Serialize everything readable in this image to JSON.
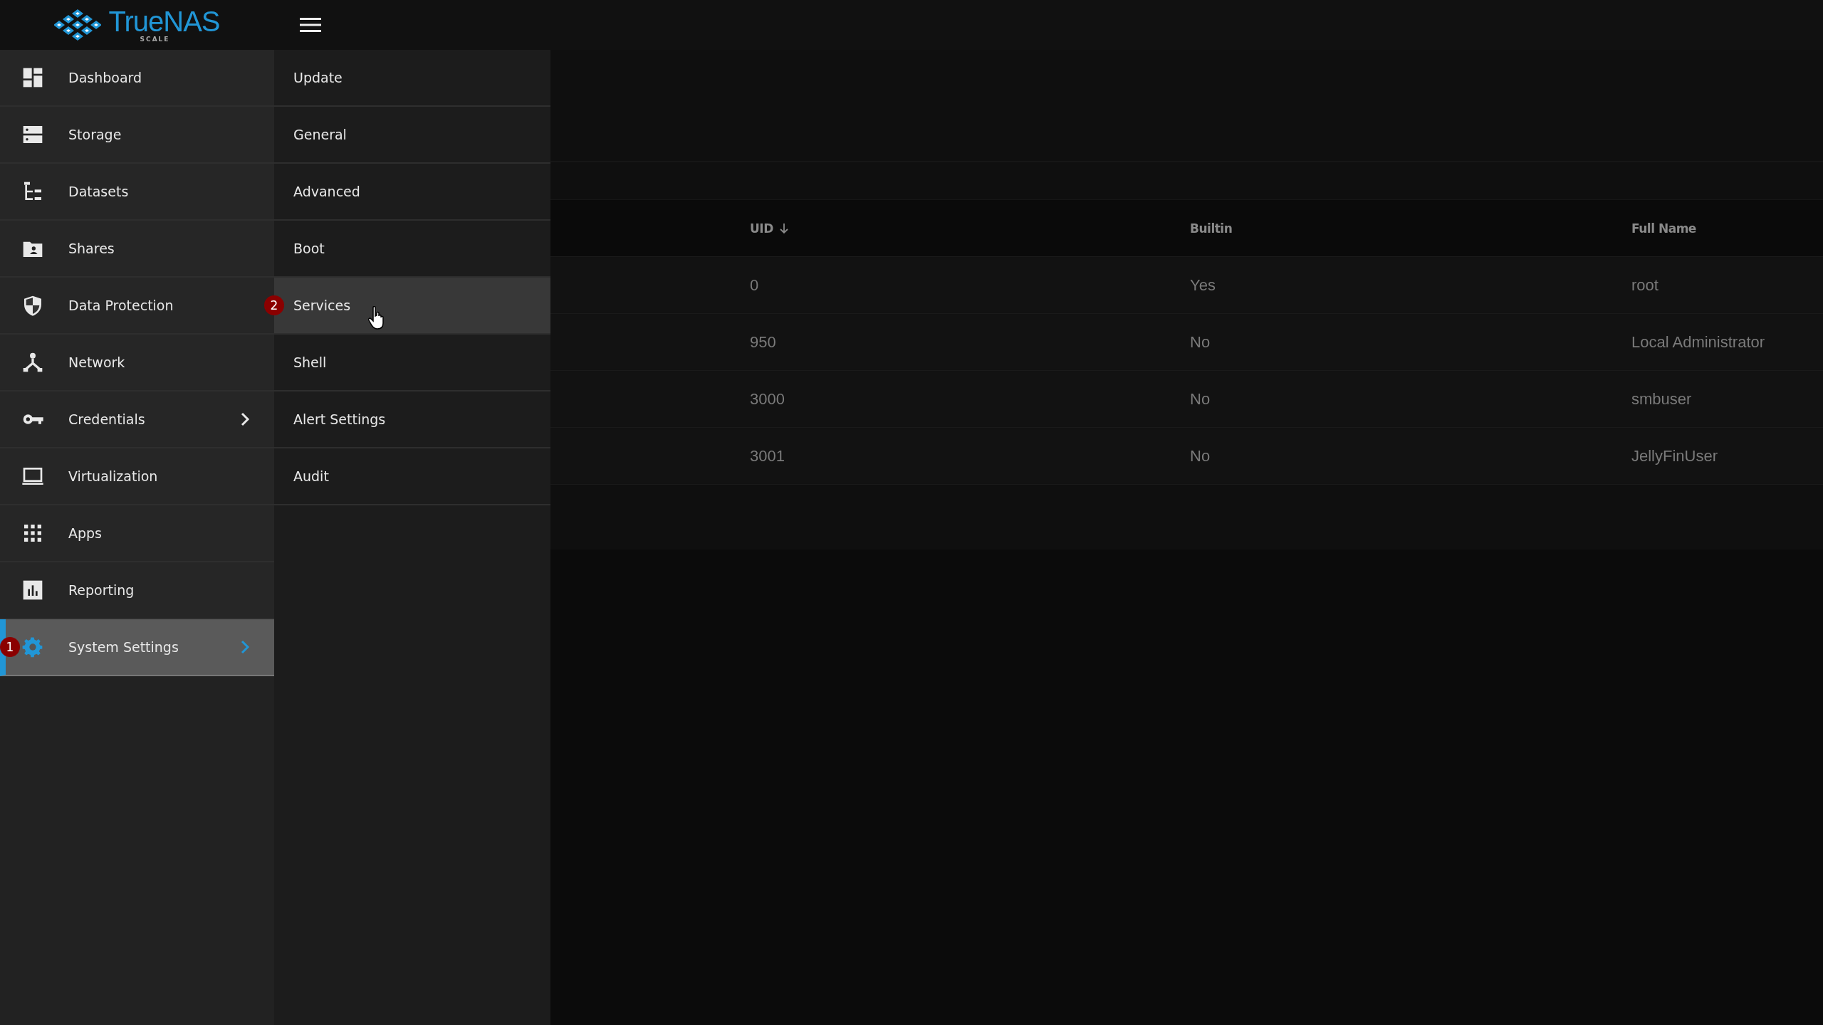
{
  "header": {
    "logo_text": "TrueNAS",
    "logo_subtext": "SCALE"
  },
  "sidebar": {
    "items": [
      {
        "label": "Dashboard",
        "selected": false,
        "expandable": false
      },
      {
        "label": "Storage",
        "selected": false,
        "expandable": false
      },
      {
        "label": "Datasets",
        "selected": false,
        "expandable": false
      },
      {
        "label": "Shares",
        "selected": false,
        "expandable": false
      },
      {
        "label": "Data Protection",
        "selected": false,
        "expandable": false
      },
      {
        "label": "Network",
        "selected": false,
        "expandable": false
      },
      {
        "label": "Credentials",
        "selected": false,
        "expandable": true
      },
      {
        "label": "Virtualization",
        "selected": false,
        "expandable": false
      },
      {
        "label": "Apps",
        "selected": false,
        "expandable": false
      },
      {
        "label": "Reporting",
        "selected": false,
        "expandable": false
      },
      {
        "label": "System Settings",
        "selected": true,
        "expandable": true,
        "badge": "1"
      }
    ]
  },
  "submenu": {
    "items": [
      {
        "label": "Update",
        "selected": false
      },
      {
        "label": "General",
        "selected": false
      },
      {
        "label": "Advanced",
        "selected": false
      },
      {
        "label": "Boot",
        "selected": false
      },
      {
        "label": "Services",
        "selected": true,
        "badge": "2"
      },
      {
        "label": "Shell",
        "selected": false
      },
      {
        "label": "Alert Settings",
        "selected": false
      },
      {
        "label": "Audit",
        "selected": false
      }
    ]
  },
  "table": {
    "columns": [
      {
        "label": "UID",
        "sorted": true
      },
      {
        "label": "Builtin",
        "sorted": false
      },
      {
        "label": "Full Name",
        "sorted": false
      }
    ],
    "rows": [
      [
        "0",
        "Yes",
        "root"
      ],
      [
        "950",
        "No",
        "Local Administrator"
      ],
      [
        "3000",
        "No",
        "smbuser"
      ],
      [
        "3001",
        "No",
        "JellyFinUser"
      ]
    ]
  }
}
